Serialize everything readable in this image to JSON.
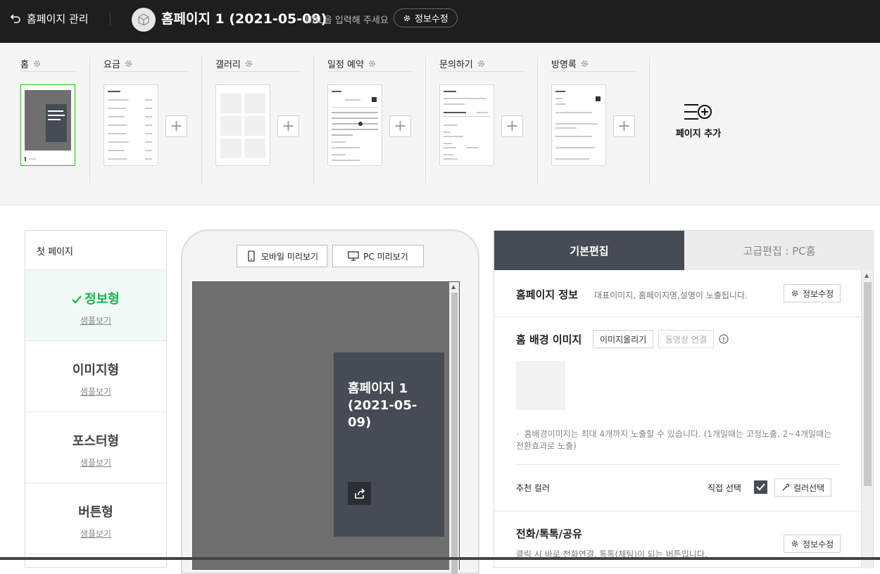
{
  "topbar": {
    "back_label": "홈페이지 관리",
    "site_title": "홈페이지 1 (2021-05-09)",
    "url_hint": "URL을 입력해 주세요",
    "info_edit": "정보수정"
  },
  "pages": [
    {
      "name": "홈"
    },
    {
      "name": "요금"
    },
    {
      "name": "갤러리"
    },
    {
      "name": "일정 예약"
    },
    {
      "name": "문의하기"
    },
    {
      "name": "방명록"
    }
  ],
  "add_page_label": "페이지 추가",
  "layouts": {
    "header": "첫 페이지",
    "items": [
      {
        "name": "정보형",
        "sample": "샘플보기",
        "selected": true
      },
      {
        "name": "이미지형",
        "sample": "샘플보기"
      },
      {
        "name": "포스터형",
        "sample": "샘플보기"
      },
      {
        "name": "버튼형",
        "sample": "샘플보기"
      }
    ]
  },
  "preview": {
    "mobile_label": "모바일 미리보기",
    "pc_label": "PC 미리보기",
    "card_title": "홈페이지 1 (2021-05-09)"
  },
  "editor": {
    "tab_basic": "기본편집",
    "tab_advanced": "고급편집 : PC홈",
    "info": {
      "title": "홈페이지 정보",
      "desc": "대표이미지, 홈페이지명,설명이 노출됩니다.",
      "button": "정보수정"
    },
    "bg": {
      "title": "홈 배경 이미지",
      "upload": "이미지올리기",
      "video": "동영상 연결",
      "note": "홈배경이미지는 최대 4개까지 노출할 수 있습니다. (1개일때는 고정노출, 2~4개일때는 전환효과로 노출)",
      "recommend": "추천 컬러",
      "direct": "직접 선택",
      "color_pick": "컬러선택"
    },
    "phone": {
      "title": "전화/톡톡/공유",
      "desc": "클릭 시 바로 전화연결, 톡톡(채팅)이 되는 버튼입니다.",
      "button": "정보수정"
    }
  },
  "colors": {
    "accent_green": "#19b44c",
    "dark_panel": "#474b55"
  }
}
